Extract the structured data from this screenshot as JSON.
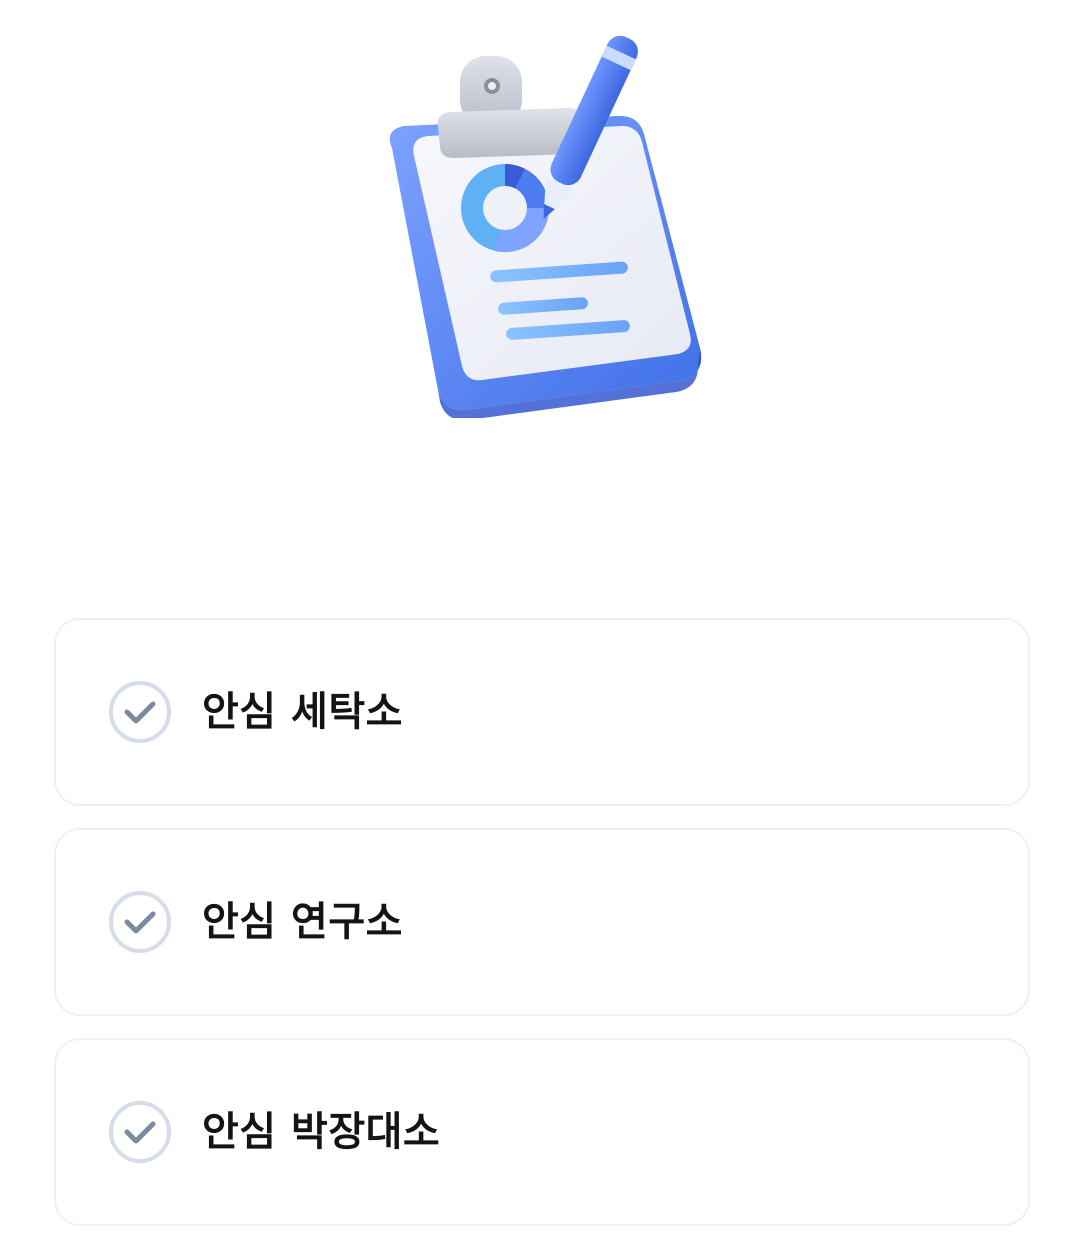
{
  "hero": {
    "icon": "clipboard-chart-pencil-icon"
  },
  "options": [
    {
      "label": "안심 세탁소",
      "checked": false,
      "icon": "check-circle-icon"
    },
    {
      "label": "안심 연구소",
      "checked": false,
      "icon": "check-circle-icon"
    },
    {
      "label": "안심 박장대소",
      "checked": false,
      "icon": "check-circle-icon"
    }
  ],
  "colors": {
    "accent": "#4f7df0",
    "check_ring": "#d5dde9",
    "check_mark": "#7c8aa1",
    "card_border": "#eef0f3",
    "text": "#121417"
  }
}
